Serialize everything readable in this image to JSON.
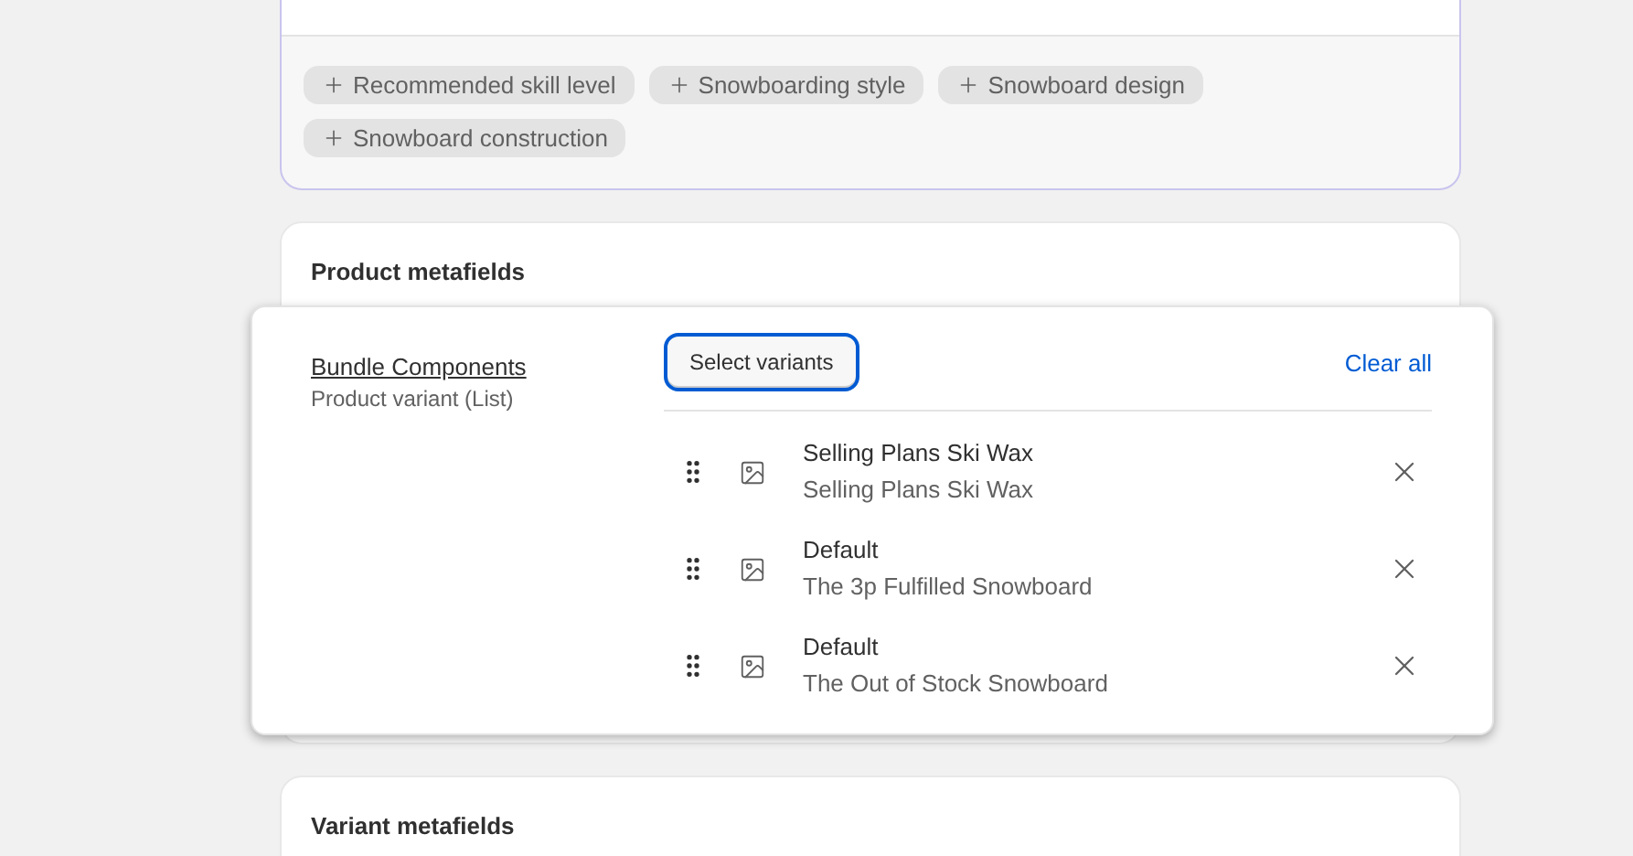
{
  "suggestions": [
    {
      "label": "Recommended skill level"
    },
    {
      "label": "Snowboarding style"
    },
    {
      "label": "Snowboard design"
    },
    {
      "label": "Snowboard construction"
    }
  ],
  "product_metafields": {
    "title": "Product metafields",
    "field": {
      "name": "Bundle Components",
      "type": "Product variant (List)"
    },
    "select_button": "Select variants",
    "clear_link": "Clear all",
    "items": [
      {
        "title": "Selling Plans Ski Wax",
        "subtitle": "Selling Plans Ski Wax"
      },
      {
        "title": "Default",
        "subtitle": "The 3p Fulfilled Snowboard"
      },
      {
        "title": "Default",
        "subtitle": "The Out of Stock Snowboard"
      }
    ]
  },
  "variant_metafields": {
    "title": "Variant metafields"
  }
}
